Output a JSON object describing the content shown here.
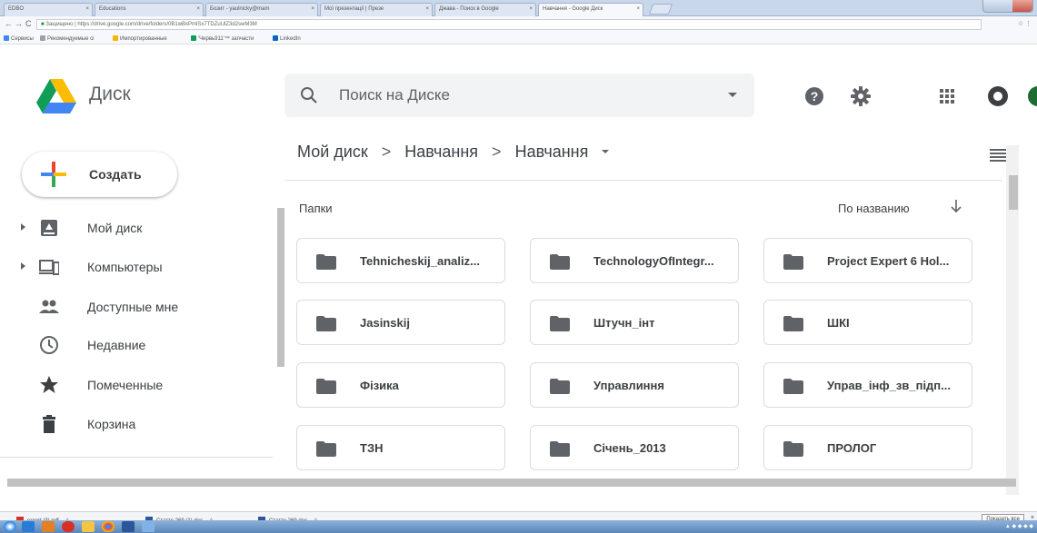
{
  "browser": {
    "tabs": [
      {
        "title": "EDBO"
      },
      {
        "title": "Educations"
      },
      {
        "title": "Бозит - yaulnicky@mam"
      },
      {
        "title": "Мої презентації | Презе"
      },
      {
        "title": "Джава - Поиск в Google"
      },
      {
        "title": "Навчання - Google Диск",
        "active": true
      }
    ],
    "address": {
      "secure_label": "Защищено",
      "url": "https://drive.google.com/drive/folders/0B1wBxPmlSx7TDZuUlZ3d2swM3M"
    },
    "bookmarks": [
      {
        "label": "Сервисы",
        "color": "#4285f4"
      },
      {
        "label": "Рекомендуемые ci",
        "color": "#9aa0a6"
      },
      {
        "label": "Импортированные",
        "color": "#f4b400"
      },
      {
        "label": "'Червь911'™ запчасти",
        "color": "#0f9d58"
      },
      {
        "label": "LinkedIn",
        "color": "#0a66c2"
      }
    ]
  },
  "header": {
    "app_name": "Диск",
    "search_placeholder": "Поиск на Диске",
    "icons": [
      "help-icon",
      "settings-gear-icon",
      "apps-grid-icon",
      "account-icon"
    ]
  },
  "sidebar": {
    "create_label": "Создать",
    "items": [
      {
        "label": "Мой диск",
        "icon": "my-drive-icon",
        "expandable": true
      },
      {
        "label": "Компьютеры",
        "icon": "computers-icon",
        "expandable": true
      },
      {
        "label": "Доступные мне",
        "icon": "shared-with-me-icon",
        "expandable": false
      },
      {
        "label": "Недавние",
        "icon": "recent-clock-icon",
        "expandable": false
      },
      {
        "label": "Помеченные",
        "icon": "starred-icon",
        "expandable": false
      },
      {
        "label": "Корзина",
        "icon": "trash-icon",
        "expandable": false
      }
    ]
  },
  "main": {
    "breadcrumbs": [
      "Мой диск",
      "Навчання",
      "Навчання"
    ],
    "breadcrumb_separator": ">",
    "section_label": "Папки",
    "sort_label": "По названию",
    "folders": [
      {
        "name": "Tehnicheskij_analiz..."
      },
      {
        "name": "TechnologyOfIntegr..."
      },
      {
        "name": "Project Expert 6 Hol..."
      },
      {
        "name": "Jasinskij"
      },
      {
        "name": "Штучн_інт"
      },
      {
        "name": "ШКІ"
      },
      {
        "name": "Фізика"
      },
      {
        "name": "Управлиння"
      },
      {
        "name": "Управ_інф_зв_підп..."
      },
      {
        "name": "ТЗН"
      },
      {
        "name": "Січень_2013"
      },
      {
        "name": "ПРОЛОГ"
      }
    ]
  },
  "downloads": {
    "items": [
      {
        "name": "report (3).pdf",
        "icon": "pdf-icon"
      },
      {
        "name": "Статте 269 (1).doc",
        "icon": "doc-icon"
      },
      {
        "name": "Статте 269.doc",
        "icon": "doc-icon"
      }
    ],
    "show_all_label": "Показать все"
  },
  "colors": {
    "folder_icon": "#5f6368",
    "text": "#3c4043",
    "search_bg": "#f1f3f4"
  }
}
